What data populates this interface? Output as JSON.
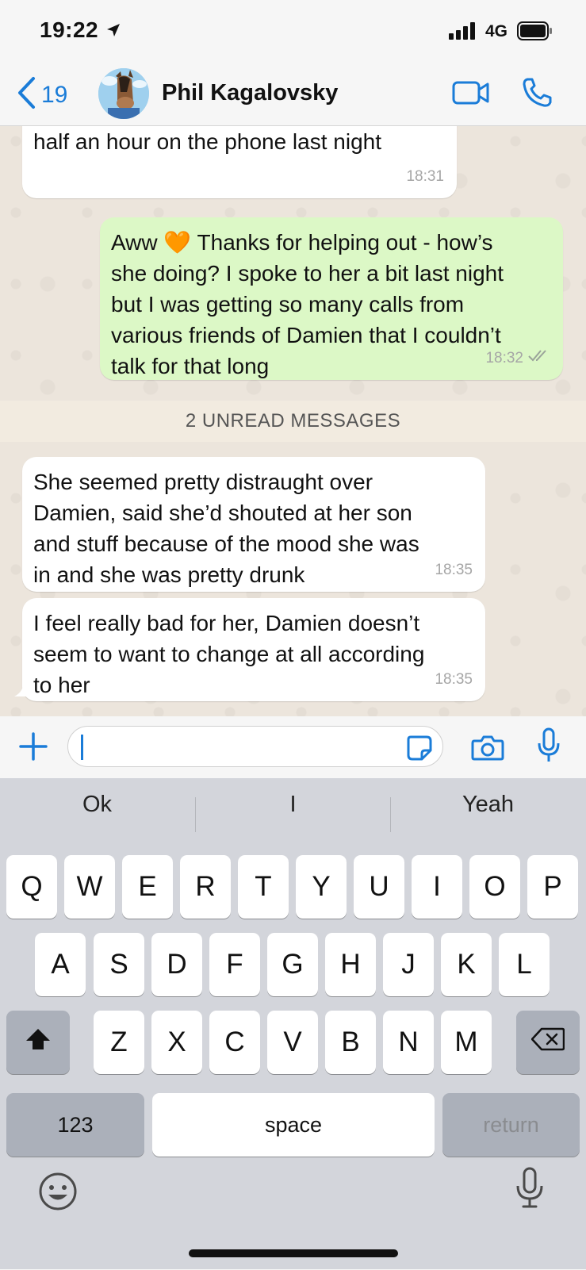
{
  "status_bar": {
    "time": "19:22",
    "network": "4G"
  },
  "header": {
    "back_count": "19",
    "contact_name": "Phil Kagalovsky"
  },
  "messages": [
    {
      "direction": "in",
      "text": "Haha yes I know I spoke to her for like\nhalf an hour on the phone last night",
      "time": "18:31"
    },
    {
      "direction": "out",
      "text": "Aww 🧡 Thanks for helping out - how’s\nshe doing? I spoke to her a bit last night\nbut I was getting so many calls from\nvarious friends of Damien that I couldn’t\ntalk for that long",
      "time": "18:32",
      "read_receipt": "double-check-icon"
    },
    {
      "direction": "in",
      "text": "She seemed pretty distraught over\nDamien, said she’d shouted at her son\nand stuff because of the mood she was\nin and she was pretty drunk",
      "time": "18:35"
    },
    {
      "direction": "in",
      "text": "I feel really bad for her, Damien doesn’t\nseem to want to change at all according\nto her",
      "time": "18:35"
    }
  ],
  "unread_banner": "2 UNREAD MESSAGES",
  "composer": {
    "input_value": "",
    "icons": [
      "plus-icon",
      "sticker-icon",
      "camera-icon",
      "microphone-icon"
    ]
  },
  "keyboard": {
    "suggestions": [
      "Ok",
      "I",
      "Yeah"
    ],
    "row1": [
      "Q",
      "W",
      "E",
      "R",
      "T",
      "Y",
      "U",
      "I",
      "O",
      "P"
    ],
    "row2": [
      "A",
      "S",
      "D",
      "F",
      "G",
      "H",
      "J",
      "K",
      "L"
    ],
    "row3": [
      "Z",
      "X",
      "C",
      "V",
      "B",
      "N",
      "M"
    ],
    "numbers_key": "123",
    "space_key": "space",
    "return_key": "return"
  },
  "colors": {
    "accent": "#1a7cd8",
    "outgoing_bubble": "#dcf8c6",
    "incoming_bubble": "#ffffff",
    "chat_background": "#ece5dc"
  }
}
